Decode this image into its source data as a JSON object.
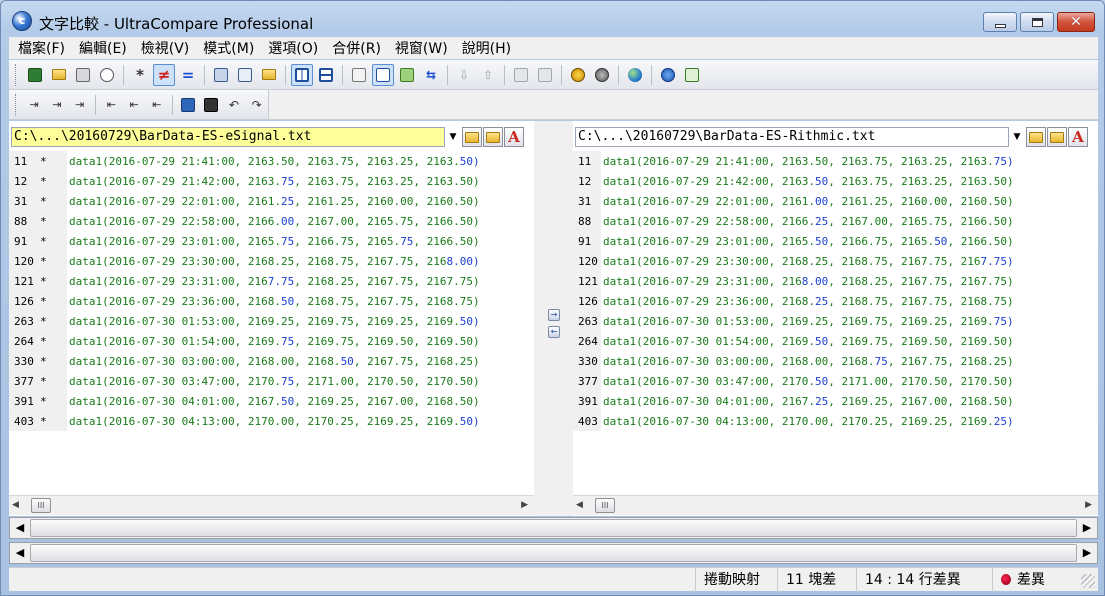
{
  "window": {
    "title": "文字比較 - UltraCompare Professional",
    "app_icon_glyph": "c"
  },
  "menu": [
    "檔案(F)",
    "編輯(E)",
    "檢視(V)",
    "模式(M)",
    "選項(O)",
    "合併(R)",
    "視窗(W)",
    "說明(H)"
  ],
  "toolbar": {
    "main": [
      "save-icon",
      "open-icon",
      "print-icon",
      "print-preview-icon",
      "show-all-icon",
      "show-differences-icon",
      "show-matches-icon",
      "binary-compare-icon",
      "hex-compare-icon",
      "folder-compare-icon",
      "vertical-split-icon",
      "horizontal-split-icon",
      "report-icon",
      "options-icon",
      "merge-icon",
      "swap-icon",
      "next-diff-icon",
      "prev-diff-icon",
      "merge-all-left-icon",
      "merge-all-right-icon",
      "recompare-icon",
      "stop-icon",
      "web-icon",
      "info-icon",
      "refresh-icon"
    ],
    "secondary": [
      "insert-left-icon",
      "insert-both-icon",
      "insert-right-icon",
      "delete-left-icon",
      "delete-both-icon",
      "delete-right-icon",
      "save-as-icon",
      "save-small-icon",
      "undo-icon",
      "redo-icon"
    ],
    "glyphs": {
      "show_all": "*",
      "show_diff": "≠",
      "show_match": "="
    }
  },
  "left_pane": {
    "path": "C:\\...\\20160729\\BarData-ES-eSignal.txt",
    "dropdown_glyph": "▼",
    "font_button_label": "A",
    "rows": [
      {
        "ln": "11",
        "mark": "*",
        "pre": "data1(2016-07-29 21:41:00, 2163.50, 2163.75, 2163.25, 2163.50)",
        "segs": []
      },
      {
        "ln": "12",
        "mark": "*",
        "text": "data1(2016-07-29 21:42:00, 2163.75, 2163.75, 2163.25, 2163.50)"
      },
      {
        "ln": "31",
        "mark": "*",
        "text": "data1(2016-07-29 22:01:00, 2161.25, 2161.25, 2160.00, 2160.50)"
      },
      {
        "ln": "88",
        "mark": "*",
        "text": "data1(2016-07-29 22:58:00, 2166.00, 2167.00, 2165.75, 2166.50)"
      },
      {
        "ln": "91",
        "mark": "*",
        "text": "data1(2016-07-29 23:01:00, 2165.75, 2166.75, 2165.75, 2166.50)"
      },
      {
        "ln": "120",
        "mark": "*",
        "text": "data1(2016-07-29 23:30:00, 2168.25, 2168.75, 2167.75, 2168.00)"
      },
      {
        "ln": "121",
        "mark": "*",
        "text": "data1(2016-07-29 23:31:00, 2167.75, 2168.25, 2167.75, 2167.75)"
      },
      {
        "ln": "126",
        "mark": "*",
        "text": "data1(2016-07-29 23:36:00, 2168.50, 2168.75, 2167.75, 2168.75)"
      },
      {
        "ln": "263",
        "mark": "*",
        "text": "data1(2016-07-30 01:53:00, 2169.25, 2169.75, 2169.25, 2169.50)"
      },
      {
        "ln": "264",
        "mark": "*",
        "text": "data1(2016-07-30 01:54:00, 2169.75, 2169.75, 2169.50, 2169.50)"
      },
      {
        "ln": "330",
        "mark": "*",
        "text": "data1(2016-07-30 03:00:00, 2168.00, 2168.50, 2167.75, 2168.25)"
      },
      {
        "ln": "377",
        "mark": "*",
        "text": "data1(2016-07-30 03:47:00, 2170.75, 2171.00, 2170.50, 2170.50)"
      },
      {
        "ln": "391",
        "mark": "*",
        "text": "data1(2016-07-30 04:01:00, 2167.50, 2169.25, 2167.00, 2168.50)"
      },
      {
        "ln": "403",
        "mark": "*",
        "text": "data1(2016-07-30 04:13:00, 2170.00, 2170.25, 2169.25, 2169.50)"
      }
    ]
  },
  "right_pane": {
    "path": "C:\\...\\20160729\\BarData-ES-Rithmic.txt",
    "dropdown_glyph": "▼",
    "font_button_label": "A",
    "rows": [
      {
        "ln": "11",
        "text": "data1(2016-07-29 21:41:00, 2163.50, 2163.75, 2163.25, 2163.75)"
      },
      {
        "ln": "12",
        "text": "data1(2016-07-29 21:42:00, 2163.50, 2163.75, 2163.25, 2163.50)"
      },
      {
        "ln": "31",
        "text": "data1(2016-07-29 22:01:00, 2161.00, 2161.25, 2160.00, 2160.50)"
      },
      {
        "ln": "88",
        "text": "data1(2016-07-29 22:58:00, 2166.25, 2167.00, 2165.75, 2166.50)"
      },
      {
        "ln": "91",
        "text": "data1(2016-07-29 23:01:00, 2165.50, 2166.75, 2165.50, 2166.50)"
      },
      {
        "ln": "120",
        "text": "data1(2016-07-29 23:30:00, 2168.25, 2168.75, 2167.75, 2167.75)"
      },
      {
        "ln": "121",
        "text": "data1(2016-07-29 23:31:00, 2168.00, 2168.25, 2167.75, 2167.75)"
      },
      {
        "ln": "126",
        "text": "data1(2016-07-29 23:36:00, 2168.25, 2168.75, 2167.75, 2168.75)"
      },
      {
        "ln": "263",
        "text": "data1(2016-07-30 01:53:00, 2169.25, 2169.75, 2169.25, 2169.75)"
      },
      {
        "ln": "264",
        "text": "data1(2016-07-30 01:54:00, 2169.50, 2169.75, 2169.50, 2169.50)"
      },
      {
        "ln": "330",
        "text": "data1(2016-07-30 03:00:00, 2168.00, 2168.75, 2167.75, 2168.25)"
      },
      {
        "ln": "377",
        "text": "data1(2016-07-30 03:47:00, 2170.50, 2171.00, 2170.50, 2170.50)"
      },
      {
        "ln": "391",
        "text": "data1(2016-07-30 04:01:00, 2167.25, 2169.25, 2167.00, 2168.50)"
      },
      {
        "ln": "403",
        "text": "data1(2016-07-30 04:13:00, 2170.00, 2170.25, 2169.25, 2169.25)"
      }
    ]
  },
  "scroll": {
    "left_arrow": "◀",
    "right_arrow": "▶",
    "thumb_glyph": "III"
  },
  "merge": {
    "to_right": "→",
    "to_left": "←"
  },
  "status": {
    "scroll_sync": "捲動映射",
    "block_diffs": "11 塊差異",
    "line_diffs": "14 : 14 行差異",
    "diff_indicator": "差異"
  },
  "colors": {
    "match_text": "#1a7a1a",
    "diff_text": "#1b3fd0",
    "left_path_bg": "#ffff99"
  }
}
